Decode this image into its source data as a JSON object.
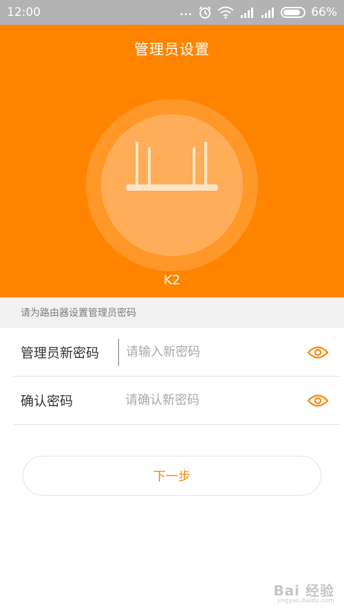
{
  "status_bar": {
    "time": "12:00",
    "dots": "...",
    "battery": "66%",
    "icons": [
      "alarm-icon",
      "wifi-icon",
      "signal-icon",
      "signal-icon",
      "battery-icon"
    ]
  },
  "header": {
    "title": "管理员设置",
    "device_name": "K2",
    "icon": "router-icon",
    "background_color": "#ff8400"
  },
  "hint": "请为路由器设置管理员密码",
  "fields": [
    {
      "label": "管理员新密码",
      "placeholder": "请输入新密码",
      "value": "",
      "toggle_icon": "eye-icon"
    },
    {
      "label": "确认密码",
      "placeholder": "请确认新密码",
      "value": "",
      "toggle_icon": "eye-icon"
    }
  ],
  "next_button": {
    "label": "下一步",
    "color": "#ff8400"
  },
  "watermark": {
    "brand": "Bai 经验",
    "url": "jingyan.baidu.com"
  }
}
